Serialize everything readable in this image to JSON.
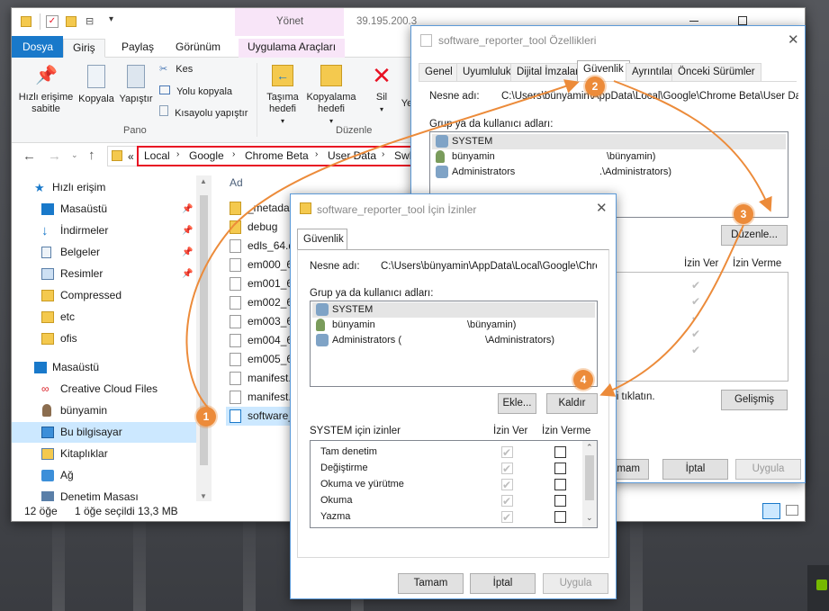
{
  "explorer": {
    "manage_tab": "Yönet",
    "window_title": "39.195.200.3",
    "tabs": [
      "Dosya",
      "Giriş",
      "Paylaş",
      "Görünüm",
      "Uygulama Araçları"
    ],
    "ribbon": {
      "pin_label": "Hızlı erişime sabitle",
      "copy_label": "Kopyala",
      "paste_label": "Yapıştır",
      "cut_label": "Kes",
      "copy_path_label": "Yolu kopyala",
      "paste_shortcut_label": "Kısayolu yapıştır",
      "clipboard_group": "Pano",
      "move_to_label": "Taşıma hedefi",
      "copy_to_label": "Kopyalama hedefi",
      "delete_label": "Sil",
      "rename_label": "Ye",
      "organize_group": "Düzenle"
    },
    "breadcrumb": [
      "Local",
      "Google",
      "Chrome Beta",
      "User Data",
      "SwR"
    ],
    "breadcrumb_overflow": "«",
    "nav": [
      {
        "label": "Hızlı erişim",
        "icon": "star-icon"
      },
      {
        "label": "Masaüstü",
        "icon": "desktop-icon",
        "pinned": true
      },
      {
        "label": "İndirmeler",
        "icon": "download-icon",
        "pinned": true
      },
      {
        "label": "Belgeler",
        "icon": "documents-icon",
        "pinned": true
      },
      {
        "label": "Resimler",
        "icon": "pictures-icon",
        "pinned": true
      },
      {
        "label": "Compressed",
        "icon": "folder-icon"
      },
      {
        "label": "etc",
        "icon": "folder-icon"
      },
      {
        "label": "ofis",
        "icon": "folder-icon"
      },
      {
        "label": "Masaüstü",
        "icon": "desktop-icon"
      },
      {
        "label": "Creative Cloud Files",
        "icon": "creative-cloud-icon"
      },
      {
        "label": "bünyamin",
        "icon": "user-icon"
      },
      {
        "label": "Bu bilgisayar",
        "icon": "computer-icon",
        "selected": true
      },
      {
        "label": "Kitaplıklar",
        "icon": "library-icon"
      },
      {
        "label": "Ağ",
        "icon": "network-icon"
      },
      {
        "label": "Denetim Masası",
        "icon": "control-panel-icon"
      }
    ],
    "column_header": "Ad",
    "files": [
      "_metadat",
      "debug",
      "edls_64.d",
      "em000_64",
      "em001_64",
      "em002_64",
      "em003_64",
      "em004_64",
      "em005_64",
      "manifest.",
      "manifest.",
      "software_"
    ],
    "status": {
      "count": "12 öğe",
      "selected": "1 öğe seçildi",
      "size": "13,3 MB"
    }
  },
  "props": {
    "title": "software_reporter_tool Özellikleri",
    "tabs": [
      "Genel",
      "Uyumluluk",
      "Dijital İmzalar",
      "Güvenlik",
      "Ayrıntılar",
      "Önceki Sürümler"
    ],
    "object_label": "Nesne adı:",
    "object_value": "C:\\Users\\bünyamin\\AppData\\Local\\Google\\Chrome Beta\\User Da",
    "group_label": "Grup ya da kullanıcı adları:",
    "users": [
      {
        "name": "SYSTEM",
        "suffix": ""
      },
      {
        "name": "bünyamin",
        "suffix": "\\bünyamin)"
      },
      {
        "name": "Administrators",
        "suffix": ".\\Administrators)"
      }
    ],
    "edit_button": "Düzenle...",
    "allow_header": "İzin Ver",
    "deny_header": "İzin Verme",
    "advanced_hint": "şi tıklatın.",
    "advanced_button": "Gelişmiş",
    "ok_button": "amam",
    "cancel_button": "İptal",
    "apply_button": "Uygula"
  },
  "perms": {
    "title": "software_reporter_tool İçin İzinler",
    "tab": "Güvenlik",
    "object_label": "Nesne adı:",
    "object_value": "C:\\Users\\bünyamin\\AppData\\Local\\Google\\Chron",
    "group_label": "Grup ya da kullanıcı adları:",
    "users": [
      {
        "name": "SYSTEM",
        "suffix": ""
      },
      {
        "name": "bünyamin",
        "suffix": "\\bünyamin)"
      },
      {
        "name": "Administrators (",
        "suffix": "\\Administrators)"
      }
    ],
    "add_button": "Ekle...",
    "remove_button": "Kaldır",
    "permissions_for": "SYSTEM için izinler",
    "allow_header": "İzin Ver",
    "deny_header": "İzin Verme",
    "permissions": [
      "Tam denetim",
      "Değiştirme",
      "Okuma ve yürütme",
      "Okuma",
      "Yazma"
    ],
    "ok_button": "Tamam",
    "cancel_button": "İptal",
    "apply_button": "Uygula"
  },
  "callouts": [
    "1",
    "2",
    "3",
    "4"
  ],
  "colors": {
    "accent": "#1979ca",
    "callout": "#ec8b3a",
    "highlight": "#e81123"
  }
}
